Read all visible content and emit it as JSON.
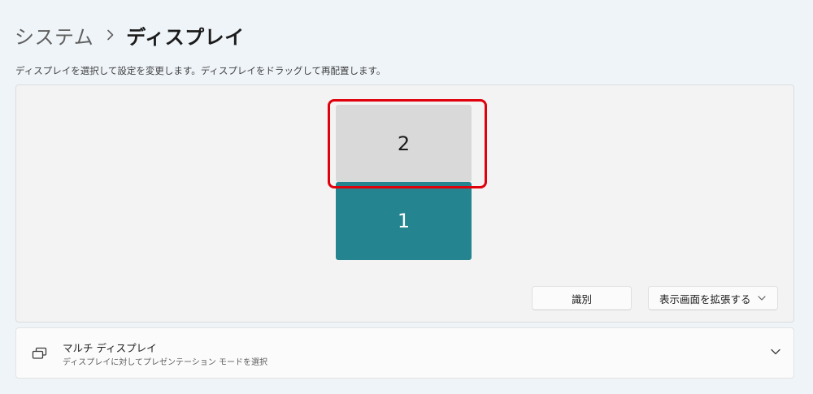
{
  "breadcrumb": {
    "parent": "システム",
    "separator_icon": "chevron-right-icon",
    "current": "ディスプレイ"
  },
  "description": "ディスプレイを選択して設定を変更します。ディスプレイをドラッグして再配置します。",
  "arrangement": {
    "monitors": [
      {
        "label": "2",
        "selected": false,
        "highlighted": true,
        "color": "#d9d9d9"
      },
      {
        "label": "1",
        "selected": true,
        "color": "#248490"
      }
    ],
    "highlight_color": "#e0000c",
    "identify_label": "識別",
    "mode_select": {
      "value": "表示画面を拡張する",
      "icon": "chevron-down-icon"
    }
  },
  "multi_display": {
    "icon": "multiple-displays-icon",
    "title": "マルチ ディスプレイ",
    "subtitle": "ディスプレイに対してプレゼンテーション モードを選択",
    "expand_icon": "chevron-down-icon"
  }
}
